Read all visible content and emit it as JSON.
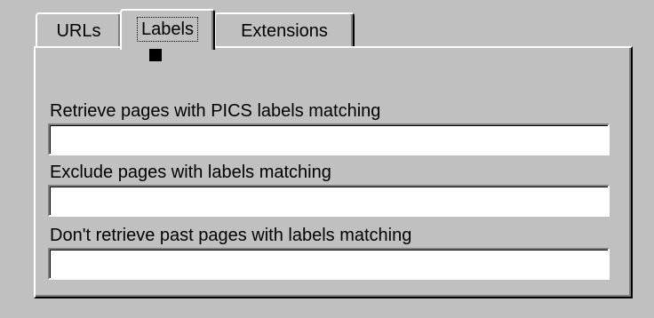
{
  "tabs": [
    {
      "label": "URLs"
    },
    {
      "label": "Labels"
    },
    {
      "label": "Extensions"
    }
  ],
  "fields": [
    {
      "label": "Retrieve pages with PICS labels matching",
      "value": ""
    },
    {
      "label": "Exclude pages with labels matching",
      "value": ""
    },
    {
      "label": "Don't retrieve past pages with labels matching",
      "value": ""
    }
  ]
}
